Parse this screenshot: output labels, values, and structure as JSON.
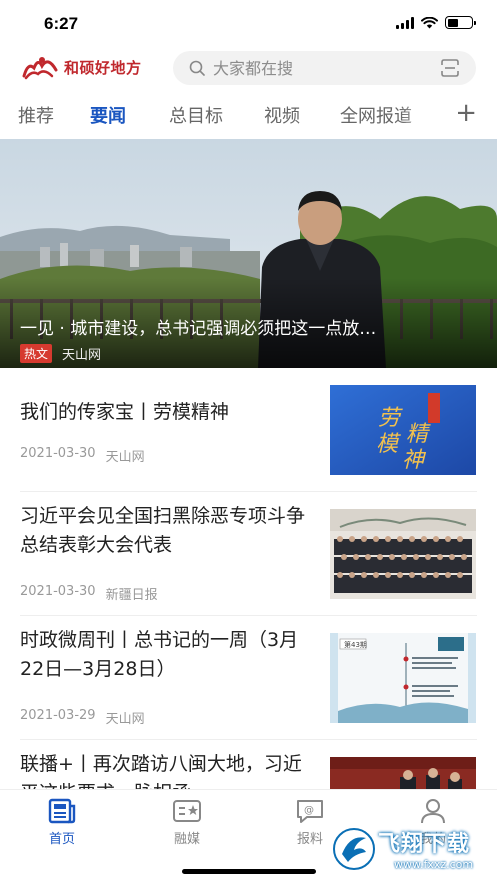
{
  "status_bar": {
    "time": "6:27",
    "battery_level": 0.45
  },
  "header": {
    "logo_text": "和硕好地方",
    "search_placeholder": "大家都在搜"
  },
  "tabs": [
    {
      "label": "推荐",
      "active": false
    },
    {
      "label": "要闻",
      "active": true
    },
    {
      "label": "总目标",
      "active": false
    },
    {
      "label": "视频",
      "active": false
    },
    {
      "label": "全网报道",
      "active": false
    }
  ],
  "tab_add_label": "+",
  "hero": {
    "title": "一见 · 城市建设，总书记强调必须把这一点放…",
    "badge": "热文",
    "source": "天山网"
  },
  "news": [
    {
      "title": "我们的传家宝丨劳模精神",
      "date": "2021-03-30",
      "source": "天山网",
      "thumb_text": [
        "劳",
        "模",
        "精",
        "神"
      ]
    },
    {
      "title": "习近平会见全国扫黑除恶专项斗争总结表彰大会代表",
      "date": "2021-03-30",
      "source": "新疆日报"
    },
    {
      "title": "时政微周刊丨总书记的一周（3月22日—3月28日）",
      "date": "2021-03-29",
      "source": "天山网",
      "thumb_badge": "第43期"
    },
    {
      "title": "联播+丨再次踏访八闽大地，习近平这些要求一脉相承",
      "date": "",
      "source": ""
    }
  ],
  "bottom_nav": [
    {
      "label": "首页",
      "icon": "news-icon",
      "active": true
    },
    {
      "label": "融媒",
      "icon": "media-icon",
      "active": false
    },
    {
      "label": "报料",
      "icon": "report-icon",
      "active": false
    },
    {
      "label": "我的",
      "icon": "user-icon",
      "active": false
    }
  ],
  "watermark": {
    "text": "飞翔下载",
    "url": "www.fxxz.com"
  },
  "colors": {
    "accent": "#1a56c0",
    "brand": "#c0282d",
    "hot": "#d63a2f"
  }
}
